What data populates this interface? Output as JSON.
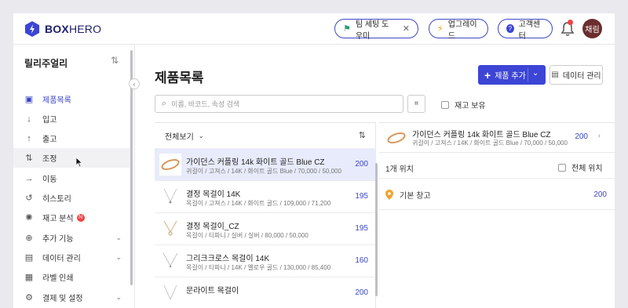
{
  "app": {
    "logo_bold": "BOX",
    "logo_light": "HERO"
  },
  "header": {
    "team_setup_label": "팀 세팅 도우미",
    "upgrade_label": "업그레이드",
    "support_label": "고객센터",
    "avatar_text": "채림",
    "notification_badge": "N"
  },
  "sidebar": {
    "workspace": "릴리주얼리",
    "items": [
      {
        "label": "제품목록",
        "icon": "box-icon"
      },
      {
        "label": "입고",
        "icon": "arrow-down-icon"
      },
      {
        "label": "출고",
        "icon": "arrow-up-icon"
      },
      {
        "label": "조정",
        "icon": "adjust-icon"
      },
      {
        "label": "이동",
        "icon": "arrow-right-icon"
      },
      {
        "label": "히스토리",
        "icon": "history-icon"
      },
      {
        "label": "재고 분석",
        "icon": "analytics-icon",
        "badge": "N"
      },
      {
        "label": "추가 기능",
        "icon": "plus-circle-icon"
      },
      {
        "label": "데이터 관리",
        "icon": "database-icon"
      },
      {
        "label": "라벨 인쇄",
        "icon": "label-icon"
      },
      {
        "label": "결제 및 설정",
        "icon": "gear-icon"
      }
    ]
  },
  "main": {
    "title": "제품목록",
    "add_button": "제품 추가",
    "data_button": "데이터 관리",
    "search_placeholder": "이름, 바코드, 속성 검색",
    "stock_filter_label": "재고 보유",
    "view_filter": "전체보기"
  },
  "products": [
    {
      "name": "가이던스 커플링 14k 화이트 골드 Blue CZ",
      "meta": "귀걸이 / 고져스 / 14K / 화이트 골드 Blue / 70,000 / 50,000",
      "qty": "200"
    },
    {
      "name": "결정 목걸이 14K",
      "meta": "목걸이 / 고져스 / 14K / 화이트 골드 / 109,000 / 71,200",
      "qty": "195"
    },
    {
      "name": "결정 목걸이_CZ",
      "meta": "목걸이 / 티파니 / 실버 / 실버 / 80,000 / 50,000",
      "qty": "195"
    },
    {
      "name": "그리크크로스 목걸이 14K",
      "meta": "목걸이 / 티파니 / 14K / 옐로우 골드 / 130,000 / 85,400",
      "qty": "160"
    },
    {
      "name": "문라이트 목걸이",
      "meta": "",
      "qty": "200"
    }
  ],
  "detail": {
    "name": "가이던스 커플링 14k 화이트 골드 Blue CZ",
    "meta": "귀걸이 / 고져스 / 14K / 화이트 골드 Blue / 70,000 / 50,000",
    "qty": "200",
    "location_count": "1개 위치",
    "all_locations_label": "전체 위치",
    "locations": [
      {
        "name": "기본 창고",
        "qty": "200"
      }
    ]
  },
  "colors": {
    "accent": "#3c45d4",
    "brand": "#1d1f6b",
    "badge": "#e44444"
  }
}
